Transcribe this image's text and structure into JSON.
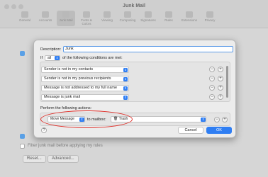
{
  "window": {
    "title": "Junk Mail",
    "toolbar": [
      "General",
      "Accounts",
      "Junk Mail",
      "Fonts & Colors",
      "Viewing",
      "Composing",
      "Signatures",
      "Rules",
      "Extensions",
      "Privacy"
    ],
    "active_tab": "Junk Mail"
  },
  "background": {
    "filter_label": "Filter junk mail before applying my rules",
    "reset_label": "Reset...",
    "advanced_label": "Advanced..."
  },
  "sheet": {
    "description_label": "Description:",
    "description_value": "Junk",
    "if_label": "If",
    "all_value": "all",
    "conditions_label": "of the following conditions are met:",
    "conditions": [
      "Sender is not in my contacts",
      "Sender is not in my previous recipients",
      "Message is not addressed to my full name",
      "Message is junk mail"
    ],
    "actions_label": "Perform the following actions:",
    "action": {
      "type": "Move Message",
      "to_mailbox_label": "to mailbox:",
      "mailbox": "Trash"
    },
    "help_label": "?",
    "cancel_label": "Cancel",
    "ok_label": "OK"
  },
  "colors": {
    "accent": "#2f7ef3",
    "annotation": "#e0312b"
  }
}
